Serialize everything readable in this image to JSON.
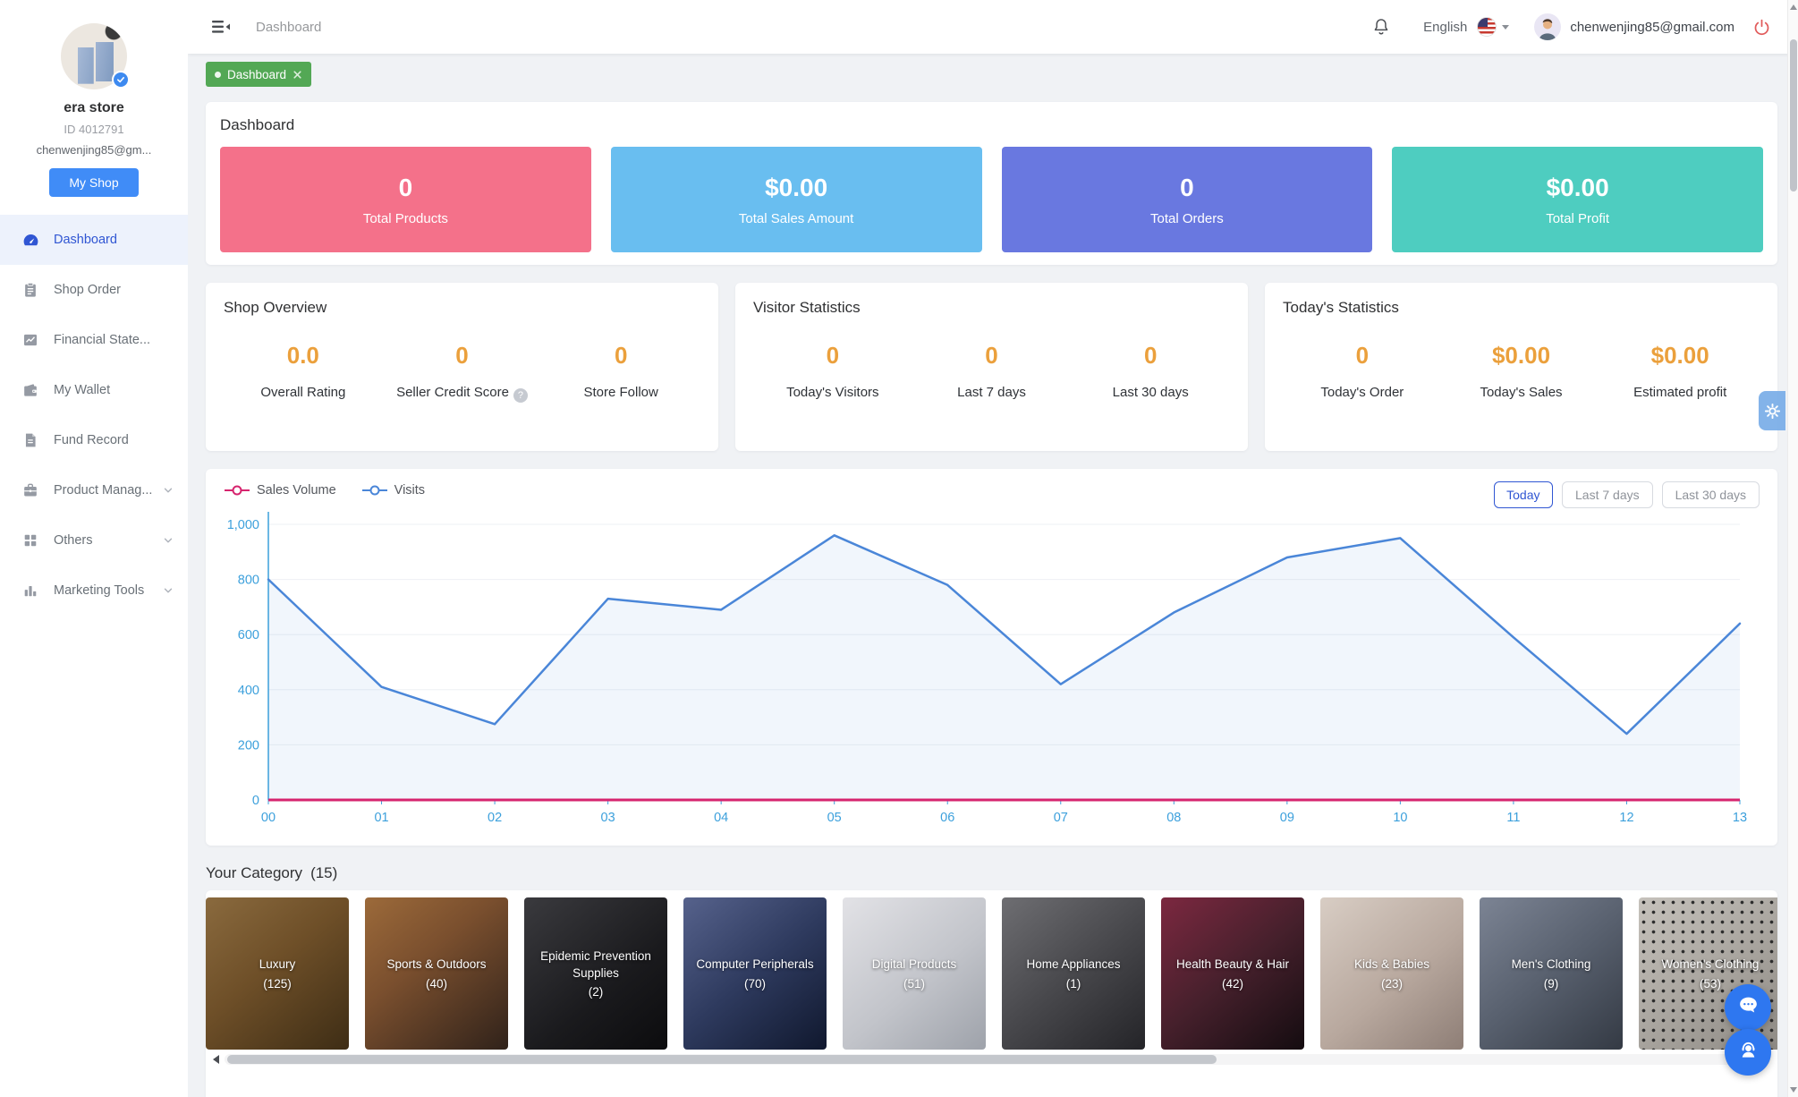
{
  "sidebar": {
    "store_name": "era store",
    "store_id": "ID 4012791",
    "email": "chenwenjing85@gm...",
    "my_shop_label": "My Shop",
    "items": [
      {
        "label": "Dashboard",
        "icon": "dashboard-icon",
        "active": true,
        "expandable": false
      },
      {
        "label": "Shop Order",
        "icon": "shop-order-icon",
        "active": false,
        "expandable": false
      },
      {
        "label": "Financial State...",
        "icon": "financial-statement-icon",
        "active": false,
        "expandable": false
      },
      {
        "label": "My Wallet",
        "icon": "wallet-icon",
        "active": false,
        "expandable": false
      },
      {
        "label": "Fund Record",
        "icon": "fund-record-icon",
        "active": false,
        "expandable": false
      },
      {
        "label": "Product Manag...",
        "icon": "product-management-icon",
        "active": false,
        "expandable": true
      },
      {
        "label": "Others",
        "icon": "others-icon",
        "active": false,
        "expandable": true
      },
      {
        "label": "Marketing Tools",
        "icon": "marketing-tools-icon",
        "active": false,
        "expandable": true
      }
    ]
  },
  "header": {
    "title": "Dashboard",
    "language": "English",
    "email": "chenwenjing85@gmail.com"
  },
  "tab": {
    "label": "Dashboard"
  },
  "overview": {
    "title": "Dashboard",
    "cards": [
      {
        "value": "0",
        "label": "Total Products",
        "color": "#f4718a"
      },
      {
        "value": "$0.00",
        "label": "Total Sales Amount",
        "color": "#69bef0"
      },
      {
        "value": "0",
        "label": "Total Orders",
        "color": "#6978e0"
      },
      {
        "value": "$0.00",
        "label": "Total Profit",
        "color": "#4ecdc0"
      }
    ]
  },
  "panels": [
    {
      "title": "Shop Overview",
      "stats": [
        {
          "value": "0.0",
          "label": "Overall Rating"
        },
        {
          "value": "0",
          "label": "Seller Credit Score",
          "help_icon": "?"
        },
        {
          "value": "0",
          "label": "Store Follow"
        }
      ]
    },
    {
      "title": "Visitor Statistics",
      "stats": [
        {
          "value": "0",
          "label": "Today's Visitors"
        },
        {
          "value": "0",
          "label": "Last 7 days"
        },
        {
          "value": "0",
          "label": "Last 30 days"
        }
      ]
    },
    {
      "title": "Today's Statistics",
      "stats": [
        {
          "value": "0",
          "label": "Today's Order"
        },
        {
          "value": "$0.00",
          "label": "Today's Sales"
        },
        {
          "value": "$0.00",
          "label": "Estimated profit"
        }
      ]
    }
  ],
  "chart_data": {
    "type": "line",
    "x": [
      "00",
      "01",
      "02",
      "03",
      "04",
      "05",
      "06",
      "07",
      "08",
      "09",
      "10",
      "11",
      "12",
      "13"
    ],
    "series": [
      {
        "name": "Sales Volume",
        "color": "#d6246e",
        "values": [
          0,
          0,
          0,
          0,
          0,
          0,
          0,
          0,
          0,
          0,
          0,
          0,
          0,
          0
        ]
      },
      {
        "name": "Visits",
        "color": "#4a86d8",
        "values": [
          800,
          410,
          275,
          730,
          690,
          960,
          780,
          420,
          680,
          880,
          950,
          590,
          240,
          640
        ]
      }
    ],
    "ylim": [
      0,
      1000
    ],
    "ytick_step": 200,
    "yticks": [
      "0",
      "200",
      "400",
      "600",
      "800",
      "1,000"
    ],
    "grid": true,
    "legend_position": "top-left",
    "range_buttons": [
      "Today",
      "Last 7 days",
      "Last 30 days"
    ],
    "active_range": "Today",
    "axis_label_color": "#3ca0dc"
  },
  "categories": {
    "title": "Your Category",
    "count": "(15)",
    "items": [
      {
        "name": "Luxury",
        "count": "(125)"
      },
      {
        "name": "Sports & Outdoors",
        "count": "(40)"
      },
      {
        "name": "Epidemic Prevention Supplies",
        "count": "(2)"
      },
      {
        "name": "Computer Peripherals",
        "count": "(70)"
      },
      {
        "name": "Digital Products",
        "count": "(51)"
      },
      {
        "name": "Home Appliances",
        "count": "(1)"
      },
      {
        "name": "Health Beauty & Hair",
        "count": "(42)"
      },
      {
        "name": "Kids & Babies",
        "count": "(23)"
      },
      {
        "name": "Men's Clothing",
        "count": "(9)"
      },
      {
        "name": "Women's Clothing",
        "count": "(53)"
      }
    ]
  },
  "accents": {
    "tab_green": "#53a855",
    "active_blue": "#3056d3",
    "stat_orange": "#eba03c",
    "my_shop_blue": "#408cf7",
    "logout_red": "#e15b5b"
  }
}
